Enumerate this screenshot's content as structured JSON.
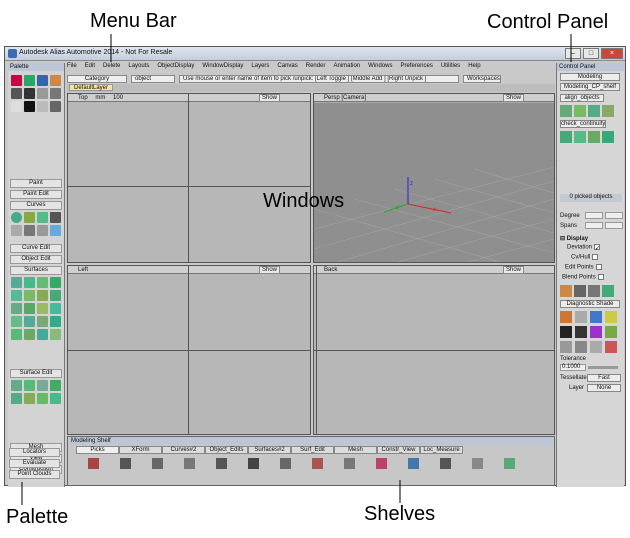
{
  "annotations": {
    "menu_bar": "Menu Bar",
    "control_panel": "Control Panel",
    "windows": "Windows",
    "palette": "Palette",
    "shelves": "Shelves"
  },
  "app": {
    "title": "Autodesk Alias Automotive 2014 - Not For Resale"
  },
  "menu": [
    "File",
    "Edit",
    "Delete",
    "Layouts",
    "ObjectDisplay",
    "WindowDisplay",
    "Layers",
    "Canvas",
    "Render",
    "Animation",
    "Windows",
    "Preferences",
    "Utilities",
    "Help"
  ],
  "toolbar": {
    "category": "Category",
    "object": "object",
    "prompt": "Use mouse or enter name of item to pick /unpick: [Left Toggle ] [Middle Add ] [Right Unpick ]",
    "workspaces": "Workspaces"
  },
  "layer": {
    "default": "DefaultLayer"
  },
  "palette": {
    "title": "Palette",
    "sections": [
      "Paint",
      "Paint Edit",
      "Curves",
      "Curve Edit",
      "Object Edit",
      "Surfaces",
      "Surface Edit",
      "Mesh",
      "View",
      "Construction",
      "Locators",
      "Evaluate",
      "Point Clouds"
    ]
  },
  "viewports": {
    "top": {
      "label": "Top",
      "units": "mm",
      "zoom": "100",
      "show": "Show"
    },
    "persp": {
      "label": "Persp [Camera]",
      "show": "Show"
    },
    "left": {
      "label": "Left",
      "show": "Show"
    },
    "back": {
      "label": "Back",
      "show": "Show"
    }
  },
  "shelf": {
    "title": "Modeling Shelf",
    "tabs": [
      "Picks",
      "XForm",
      "Curves#2",
      "Object_Edits",
      "Surfaces#2",
      "Surf_Edit",
      "Mesh",
      "Constr_View",
      "Loc_Measure"
    ]
  },
  "control_panel": {
    "title": "Control Panel",
    "mode": "Modeling",
    "shelf": "Modeling_CP_shelf",
    "tab1": "align_objects",
    "tab2": "check_continuity",
    "picked": "0 picked objects",
    "degree_label": "Degree",
    "spans_label": "Spans",
    "display_label": "Display",
    "deviation": "Deviation",
    "cvhull": "Cv/Hull",
    "edit_points": "Edit Points",
    "blend_points": "Blend Points",
    "diagnostic": "Diagnostic Shade",
    "tolerance_label": "Tolerance",
    "tolerance_value": "0.1000",
    "tessellate_label": "Tessellate",
    "tessellate_value": "Fast",
    "layer_label": "Layer",
    "layer_value": "None"
  },
  "colors": {
    "accent": "#3b6bb4",
    "layer_highlight": "#f3e59b",
    "axis_x": "#d22",
    "axis_y": "#2a2",
    "axis_z": "#22d"
  }
}
